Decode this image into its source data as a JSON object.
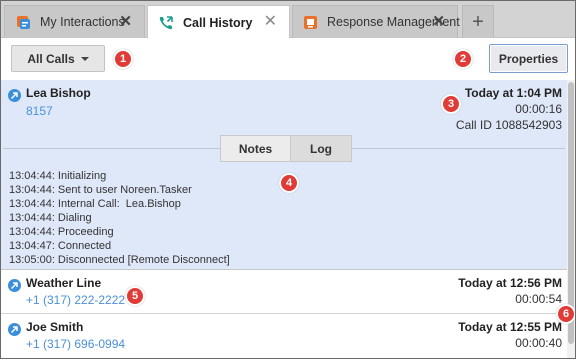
{
  "tabs": [
    {
      "label": "My Interactions",
      "icon": "interactions-icon",
      "active": false
    },
    {
      "label": "Call History",
      "icon": "phone-history-icon",
      "active": true
    },
    {
      "label": "Response Management",
      "icon": "response-management-icon",
      "active": false
    }
  ],
  "tab_close_glyph": "✕",
  "tab_add_glyph": "+",
  "toolbar": {
    "filter_label": "All Calls",
    "properties_label": "Properties"
  },
  "calls": [
    {
      "name": "Lea Bishop",
      "number": "8157",
      "time": "Today at 1:04 PM",
      "duration": "00:00:16",
      "call_id": "Call ID 1088542903",
      "expanded": true,
      "subtabs": {
        "notes": "Notes",
        "log": "Log"
      },
      "log": [
        "13:04:44: Initializing",
        "13:04:44: Sent to user Noreen.Tasker",
        "13:04:44: Internal Call:  Lea.Bishop",
        "13:04:44: Dialing",
        "13:04:44: Proceeding",
        "13:04:47: Connected",
        "13:05:00: Disconnected [Remote Disconnect]"
      ]
    },
    {
      "name": "Weather Line",
      "number": "+1 (317) 222-2222",
      "time": "Today at 12:56 PM",
      "duration": "00:00:54"
    },
    {
      "name": "Joe Smith",
      "number": "+1 (317) 696-0994",
      "time": "Today at 12:55 PM",
      "duration": "00:00:40"
    }
  ],
  "callouts": [
    "1",
    "2",
    "3",
    "4",
    "5",
    "6"
  ],
  "colors": {
    "accent_blue": "#3a8fdb",
    "link_blue": "#4a90d9",
    "expanded_row_bg": "#dfe8f8",
    "callout_red": "#e03b36",
    "tab_icon_orange": "#e8722c"
  }
}
